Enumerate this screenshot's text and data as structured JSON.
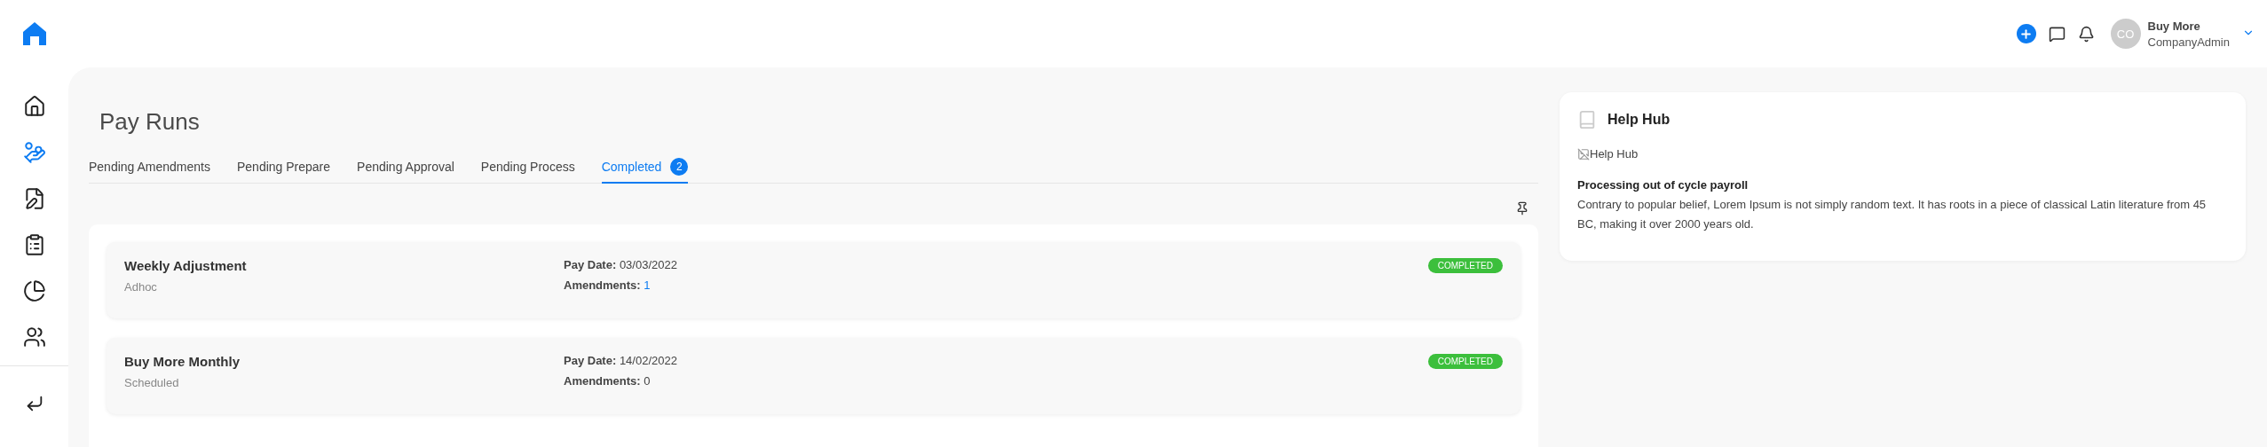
{
  "header": {
    "user": {
      "avatar_initials": "CO",
      "name": "Buy More",
      "role": "CompanyAdmin"
    }
  },
  "sidebar": {
    "items": [
      {
        "selected": false
      },
      {
        "selected": true
      },
      {
        "selected": false
      },
      {
        "selected": false
      },
      {
        "selected": false
      },
      {
        "selected": false
      }
    ]
  },
  "page": {
    "title": "Pay Runs"
  },
  "tabs": [
    {
      "label": "Pending Amendments",
      "selected": false
    },
    {
      "label": "Pending Prepare",
      "selected": false
    },
    {
      "label": "Pending Approval",
      "selected": false
    },
    {
      "label": "Pending Process",
      "selected": false
    },
    {
      "label": "Completed",
      "selected": true,
      "count": "2"
    }
  ],
  "pay_runs": [
    {
      "name": "Weekly Adjustment",
      "type": "Adhoc",
      "pay_date_label": "Pay Date:",
      "pay_date": "03/03/2022",
      "amendments_label": "Amendments:",
      "amendments": "1",
      "amendments_link": true,
      "status": "COMPLETED"
    },
    {
      "name": "Buy More Monthly",
      "type": "Scheduled",
      "pay_date_label": "Pay Date:",
      "pay_date": "14/02/2022",
      "amendments_label": "Amendments:",
      "amendments": "0",
      "amendments_link": false,
      "status": "COMPLETED"
    }
  ],
  "help_hub": {
    "title": "Help Hub",
    "image_alt": "Help Hub",
    "article_title": "Processing out of cycle payroll",
    "article_text": "Contrary to popular belief, Lorem Ipsum is not simply random text. It has roots in a piece of classical Latin literature from 45 BC, making it over 2000 years old."
  }
}
